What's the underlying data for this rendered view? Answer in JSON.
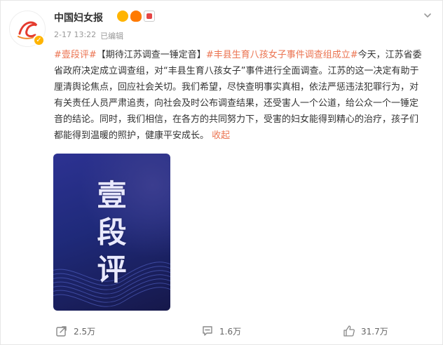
{
  "post": {
    "author": "中国妇女报",
    "date": "2-17 13:22",
    "edited_label": "已编辑",
    "hashtag1": "#壹段评#",
    "headline": "【期待江苏调查一锤定音】",
    "hashtag2": "#丰县生育八孩女子事件调查组成立#",
    "body": "今天，江苏省委省政府决定成立调查组，对“丰县生育八孩女子”事件进行全面调查。江苏的这一决定有助于厘清舆论焦点，回应社会关切。我们希望，尽快查明事实真相，依法严惩违法犯罪行为，对有关责任人员严肃追责，向社会及时公布调查结果，还受害人一个公道，给公众一个一锤定音的结论。同时，我们相信，在各方的共同努力下，受害的妇女能得到精心的治疗，孩子们都能得到温暖的照护，健康平安成长。",
    "collapse_label": "收起",
    "image_text": {
      "line1": "壹",
      "line2": "段",
      "line3": "评"
    }
  },
  "actions": {
    "share_count": "2.5万",
    "comment_count": "1.6万",
    "like_count": "31.7万"
  },
  "icons": {
    "share": "share-icon",
    "comment": "comment-icon",
    "like": "thumbs-up-icon",
    "chevron": "chevron-down-icon",
    "verified": "verified-badge-icon"
  },
  "colors": {
    "accent": "#eb7350",
    "verified": "#ffb400"
  }
}
